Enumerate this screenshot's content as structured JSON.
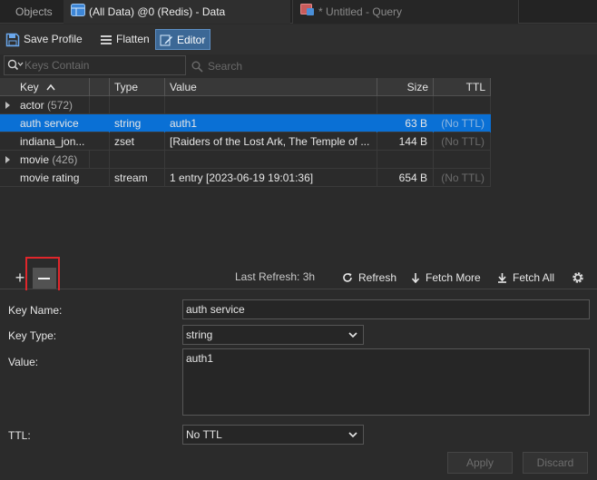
{
  "tabs": [
    {
      "label": "Objects",
      "icon": "none"
    },
    {
      "label": "(All Data) @0 (Redis) - Data",
      "icon": "grid-icon"
    },
    {
      "label": "* Untitled - Query",
      "icon": "query-icon"
    }
  ],
  "toolbar": {
    "save_profile": "Save Profile",
    "flatten": "Flatten",
    "editor": "Editor"
  },
  "search": {
    "placeholder": "Keys Contain",
    "button": "Search"
  },
  "grid": {
    "columns": [
      "Key",
      "Type",
      "Value",
      "Size",
      "TTL"
    ],
    "rows": [
      {
        "key": "actor",
        "count": "(572)",
        "group": true,
        "type": "",
        "value": "",
        "size": "",
        "ttl": ""
      },
      {
        "key": "auth service",
        "type": "string",
        "value": "auth1",
        "size": "63 B",
        "ttl": "(No TTL)",
        "selected": true
      },
      {
        "key": "indiana_jon...",
        "type": "zset",
        "value": "[Raiders of the Lost Ark, The Temple of ...",
        "size": "144 B",
        "ttl": "(No TTL)"
      },
      {
        "key": "movie",
        "count": "(426)",
        "group": true,
        "type": "",
        "value": "",
        "size": "",
        "ttl": ""
      },
      {
        "key": "movie rating",
        "type": "stream",
        "value": "1 entry [2023-06-19 19:01:36]",
        "size": "654 B",
        "ttl": "(No TTL)"
      }
    ]
  },
  "bottombar": {
    "last_refresh": "Last Refresh: 3h",
    "refresh": "Refresh",
    "fetch_more": "Fetch More",
    "fetch_all": "Fetch All"
  },
  "editor": {
    "key_name_label": "Key Name:",
    "key_name": "auth service",
    "key_type_label": "Key Type:",
    "key_type": "string",
    "value_label": "Value:",
    "value": "auth1",
    "ttl_label": "TTL:",
    "ttl": "No TTL",
    "apply": "Apply",
    "discard": "Discard"
  },
  "colors": {
    "selection": "#0a70d5",
    "highlight": "#e0262b",
    "editor_button": "#3c6896"
  }
}
